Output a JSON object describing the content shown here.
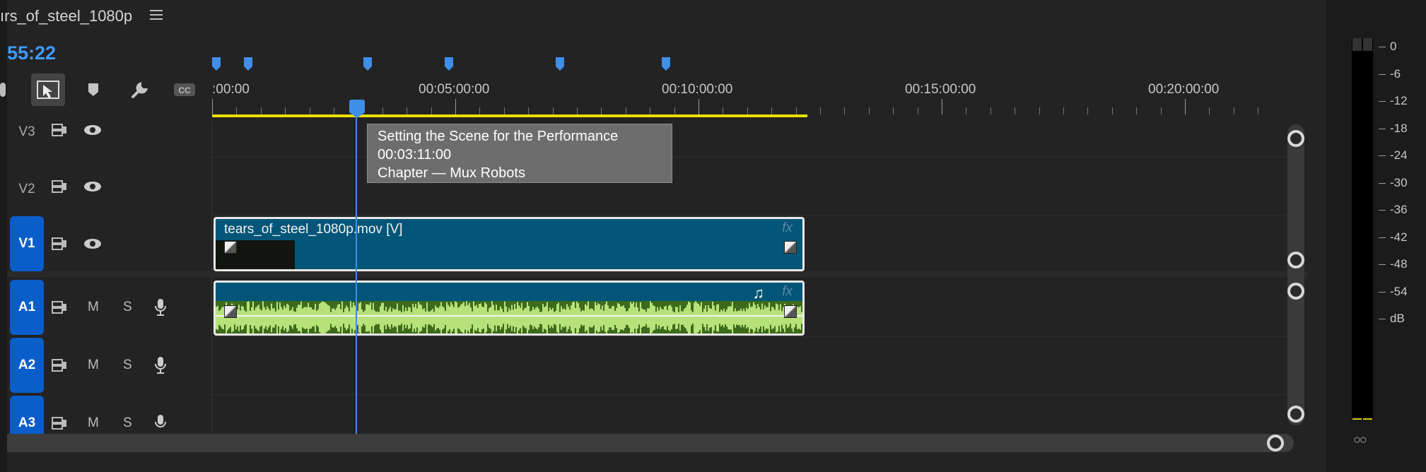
{
  "sequence": {
    "title": "ırs_of_steel_1080p",
    "timecode": "55:22"
  },
  "ruler": {
    "labels": [
      ":00:00",
      "00:05:00:00",
      "00:10:00:00",
      "00:15:00:00",
      "00:20:00:00"
    ]
  },
  "tooltip": {
    "line1": "Setting the Scene for the Performance",
    "line2": "00:03:11:00",
    "line3": "Chapter — Mux Robots"
  },
  "tracks": {
    "video": [
      "V3",
      "V2",
      "V1"
    ],
    "audio": [
      "A1",
      "A2",
      "A3"
    ],
    "mute": "M",
    "solo": "S"
  },
  "clips": {
    "video_name": "tears_of_steel_1080p.mov [V]",
    "fx": "fx",
    "music_note": "♫"
  },
  "meter": {
    "scale": [
      "0",
      "-6",
      "-12",
      "-18",
      "-24",
      "-30",
      "-36",
      "-42",
      "-48",
      "-54",
      "dB"
    ],
    "solo_label": "○○"
  },
  "colors": {
    "accent": "#3f9bff",
    "clip": "#035678",
    "inout_bar": "#e8df00",
    "selected_track": "#0a5ec9"
  },
  "icons": [
    "menu-icon",
    "selection-tool-icon",
    "linked-selection-icon",
    "marker-icon",
    "wrench-icon",
    "captions-icon",
    "toggle-sync-lock-icon",
    "eye-icon",
    "microphone-icon"
  ]
}
